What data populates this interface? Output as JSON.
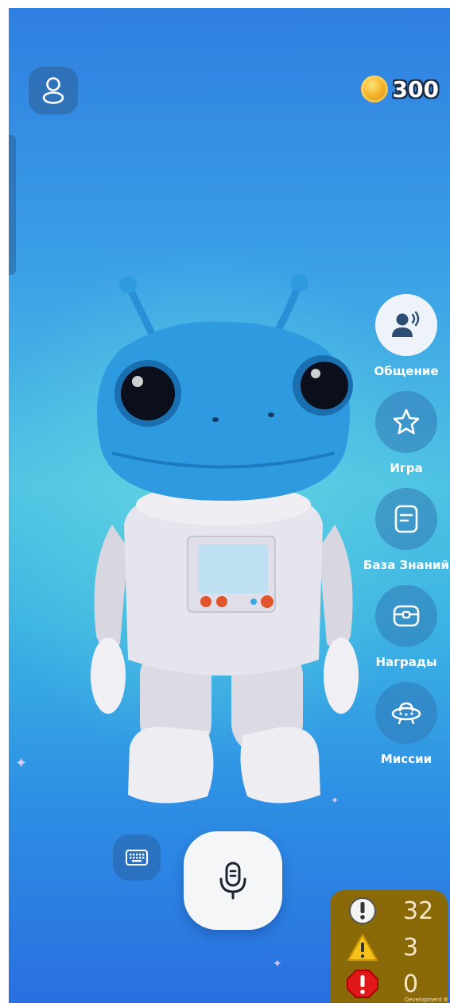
{
  "header": {
    "profile_icon": "user-icon",
    "coins": {
      "icon": "coin-icon",
      "count": "300"
    }
  },
  "menu": {
    "items": [
      {
        "label": "Общение",
        "icon": "speaking-person-icon",
        "active": true
      },
      {
        "label": "Игра",
        "icon": "star-icon",
        "active": false
      },
      {
        "label": "База Знаний",
        "icon": "document-icon",
        "active": false
      },
      {
        "label": "Награды",
        "icon": "treasure-chest-icon",
        "active": false
      },
      {
        "label": "Миссии",
        "icon": "ufo-icon",
        "active": false
      }
    ]
  },
  "controls": {
    "keyboard_icon": "keyboard-icon",
    "mic_icon": "microphone-icon"
  },
  "dev_panel": {
    "info_count": "32",
    "warning_count": "3",
    "error_count": "0",
    "footer_text": "Development B"
  },
  "colors": {
    "active_menu_bg": "#eef3f9",
    "menu_bg": "#3278b4",
    "dev_panel_bg": "#8a6a08",
    "alien_skin": "#2e9be0",
    "suit": "#e8e6ee"
  }
}
